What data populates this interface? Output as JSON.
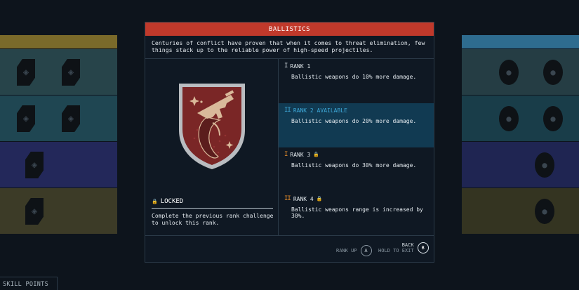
{
  "modal": {
    "title": "BALLISTICS",
    "description": "Centuries of conflict have proven that when it comes to threat elimination, few things stack up to the reliable power of high-speed projectiles.",
    "status_label": "LOCKED",
    "status_text": "Complete the previous rank challenge to unlock this rank.",
    "ranks": [
      {
        "bars": "I",
        "label": "RANK 1",
        "desc": "Ballistic weapons do 10% more damage.",
        "locked": false,
        "bar_color": "#cfd7dd"
      },
      {
        "bars": "II",
        "label": "RANK 2 AVAILABLE",
        "desc": "Ballistic weapons do 20% more damage.",
        "locked": false,
        "bar_color": "#3ea8d8"
      },
      {
        "bars": "I",
        "label": "RANK 3",
        "desc": "Ballistic weapons do 30% more damage.",
        "locked": true,
        "bar_color": "#e08a2a"
      },
      {
        "bars": "II",
        "label": "RANK 4",
        "desc": "Ballistic weapons range is increased by 30%.",
        "locked": true,
        "bar_color": "#e08a2a"
      }
    ],
    "footer": {
      "rank_up_label": "RANK UP",
      "rank_up_key": "A",
      "back_label": "BACK",
      "back_hint": "HOLD TO EXIT",
      "back_key": "B"
    }
  },
  "skill_points_label": "SKILL POINTS",
  "colors": {
    "header_red": "#c0392b",
    "active_rank_bg": "#113a52",
    "active_rank_text": "#3ea8d8",
    "badge_red": "#8a2a2a"
  }
}
